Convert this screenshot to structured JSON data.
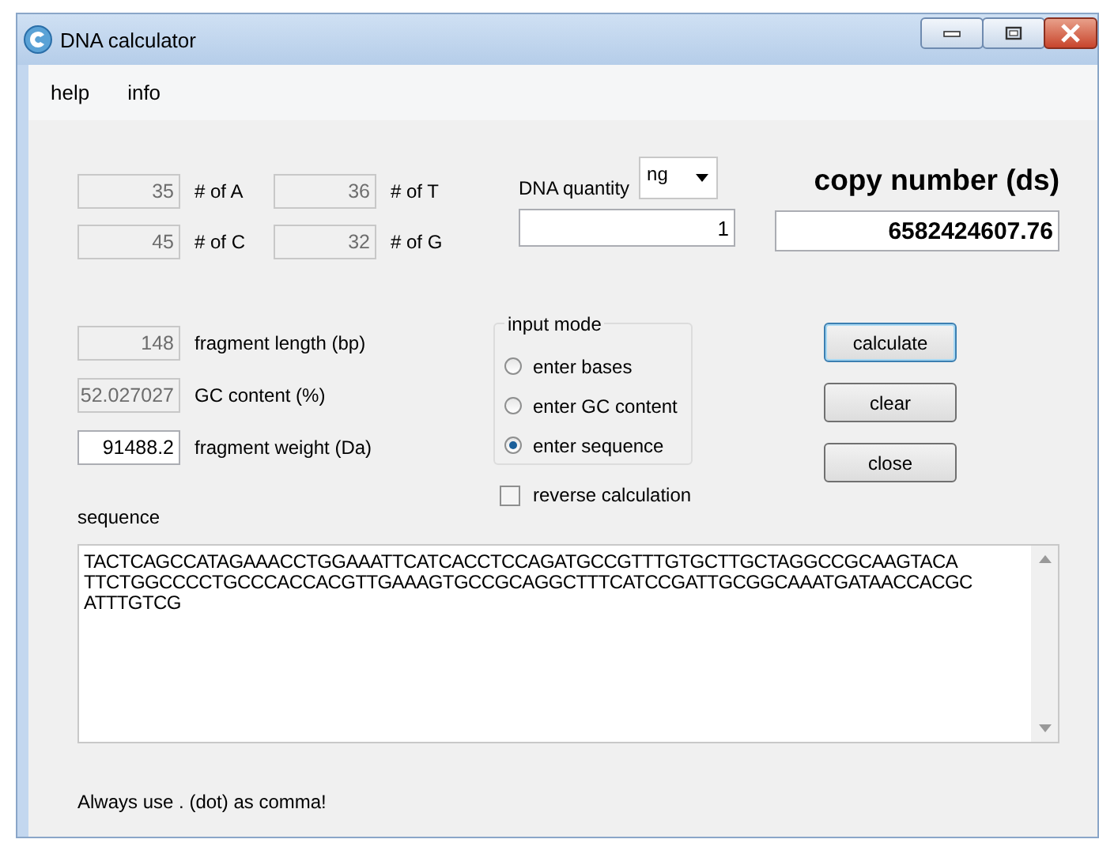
{
  "window": {
    "title": "DNA calculator"
  },
  "menu": [
    "help",
    "info"
  ],
  "base_counts": [
    {
      "value": "35",
      "label": "# of A",
      "disabled": true
    },
    {
      "value": "36",
      "label": "# of T",
      "disabled": true
    },
    {
      "value": "45",
      "label": "# of C",
      "disabled": true
    },
    {
      "value": "32",
      "label": "# of G",
      "disabled": true
    }
  ],
  "quantity": {
    "label": "DNA quantity",
    "unit": "ng",
    "value": "1"
  },
  "copy_number": {
    "label": "copy number (ds)",
    "value": "6582424607.76"
  },
  "properties": [
    {
      "value": "148",
      "label": "fragment length (bp)",
      "disabled": true
    },
    {
      "value": "52.027027",
      "label": "GC content (%)",
      "disabled": true
    },
    {
      "value": "91488.2",
      "label": "fragment weight (Da)",
      "disabled": false
    }
  ],
  "input_mode": {
    "title": "input mode",
    "options": [
      {
        "label": "enter bases",
        "selected": false
      },
      {
        "label": "enter GC content",
        "selected": false
      },
      {
        "label": "enter sequence",
        "selected": true
      }
    ]
  },
  "reverse_calculation": {
    "label": "reverse calculation",
    "checked": false
  },
  "buttons": [
    {
      "label": "calculate",
      "focused": true
    },
    {
      "label": "clear",
      "focused": false
    },
    {
      "label": "close",
      "focused": false
    }
  ],
  "sequence": {
    "label": "sequence",
    "lines": [
      "TACTCAGCCATAGAAACCTGGAAATTCATCACCTCCAGATGCCGTTTGTGCTTGCTAGGCCGCAAGTACA",
      "TTCTGGCCCCTGCCCACCACGTTGAAAGTGCCGCAGGCTTTCATCCGATTGCGGCAAATGATAACCACGC",
      "ATTTGTCG"
    ]
  },
  "footer": "Always use . (dot) as comma!"
}
